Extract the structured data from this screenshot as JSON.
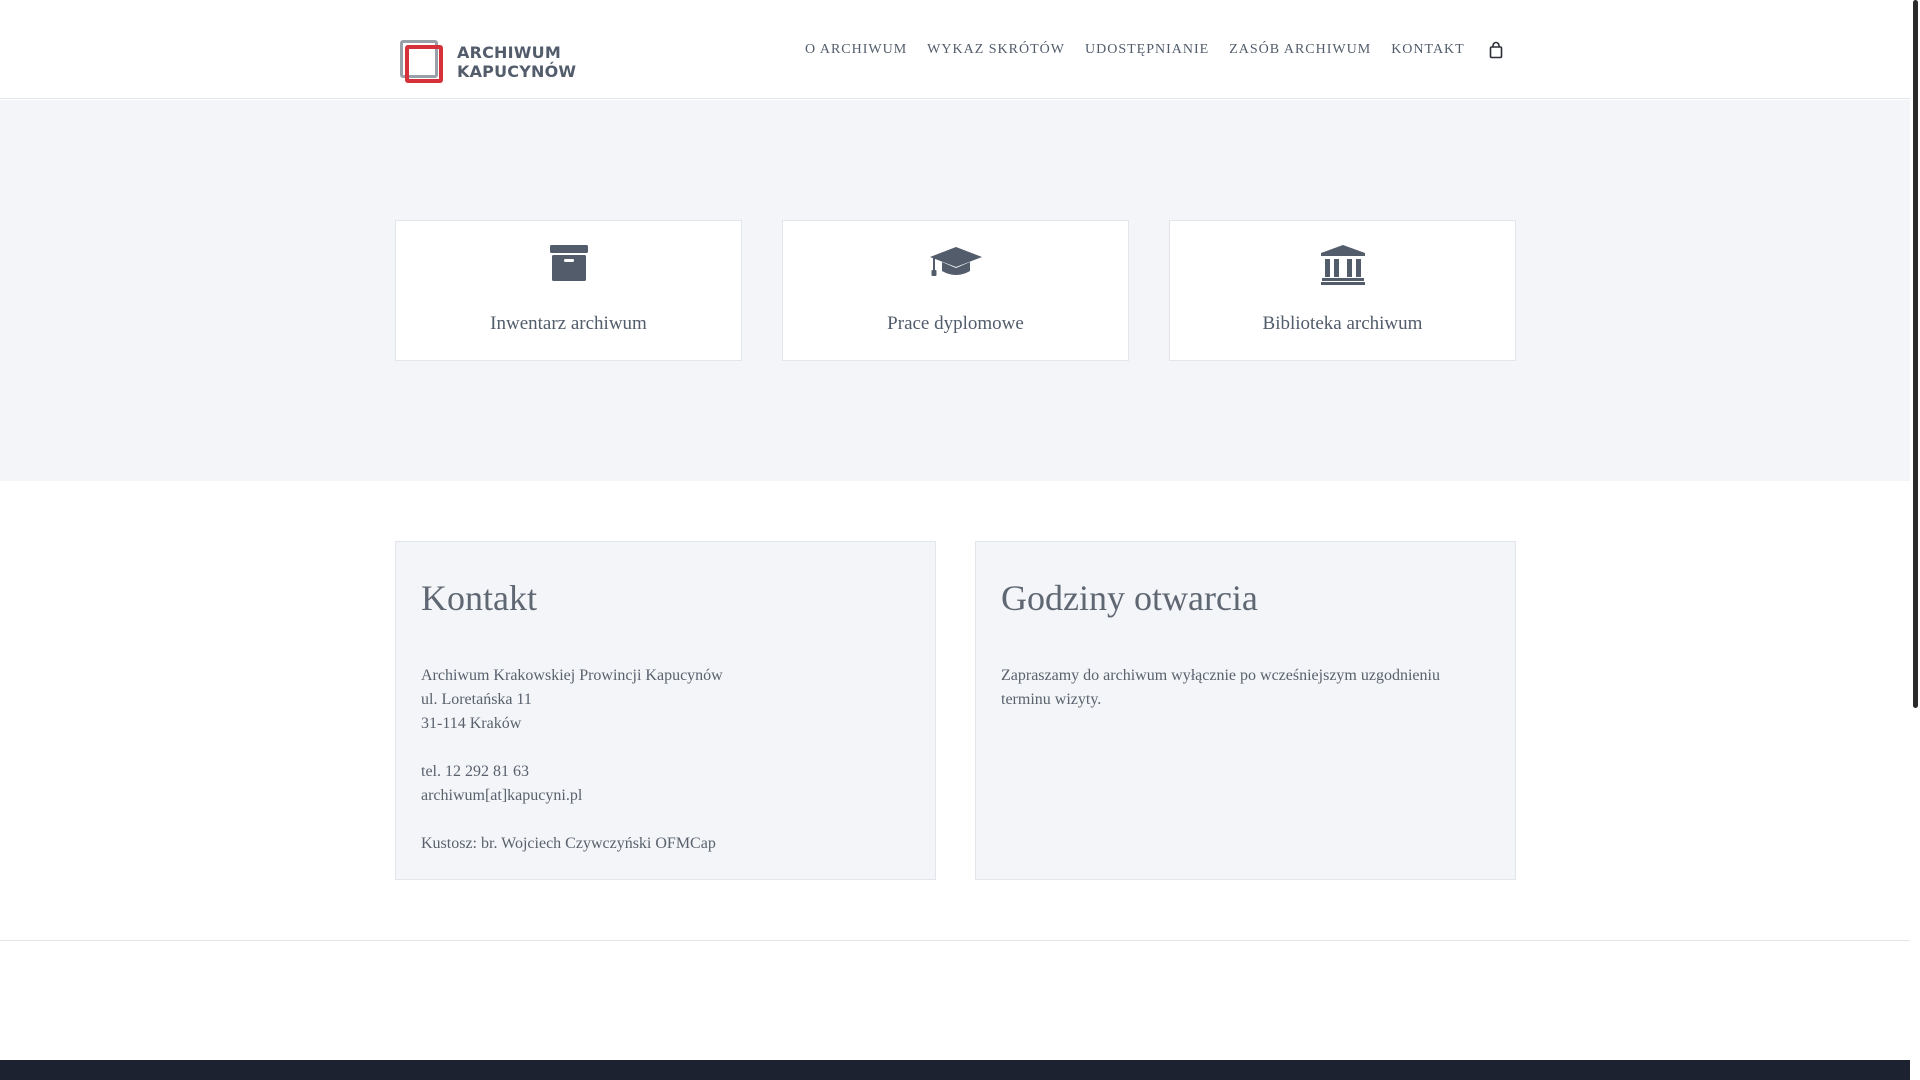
{
  "logo": {
    "line1": "ARCHIWUM",
    "line2": "KAPUCYNÓW"
  },
  "nav": {
    "items": [
      {
        "label": "O ARCHIWUM"
      },
      {
        "label": "WYKAZ SKRÓTÓW"
      },
      {
        "label": "UDOSTĘPNIANIE"
      },
      {
        "label": "ZASÓB ARCHIWUM"
      },
      {
        "label": "KONTAKT"
      }
    ],
    "cart_icon": "shopping-bag-icon"
  },
  "cards": [
    {
      "icon": "archive-box-icon",
      "label": "Inwentarz archiwum"
    },
    {
      "icon": "graduation-cap-icon",
      "label": "Prace dyplomowe"
    },
    {
      "icon": "university-icon",
      "label": "Biblioteka archiwum"
    }
  ],
  "contact": {
    "title": "Kontakt",
    "lines": [
      "Archiwum Krakowskiej Prowincji Kapucynów",
      "ul. Loretańska 11",
      "31-114 Kraków",
      "tel. 12  292 81 63",
      "archiwum[at]kapucyni.pl",
      "Kustosz: br. Wojciech Czywczyński OFMCap"
    ]
  },
  "hours": {
    "title": "Godziny otwarcia",
    "text": "Zapraszamy do archiwum wyłącznie po wcześniejszym uzgodnieniu terminu wizyty."
  },
  "colors": {
    "brand_red": "#d4313b",
    "text": "#525c6b",
    "section_bg": "#f4f5f8",
    "footer_bg": "#1d2230"
  }
}
